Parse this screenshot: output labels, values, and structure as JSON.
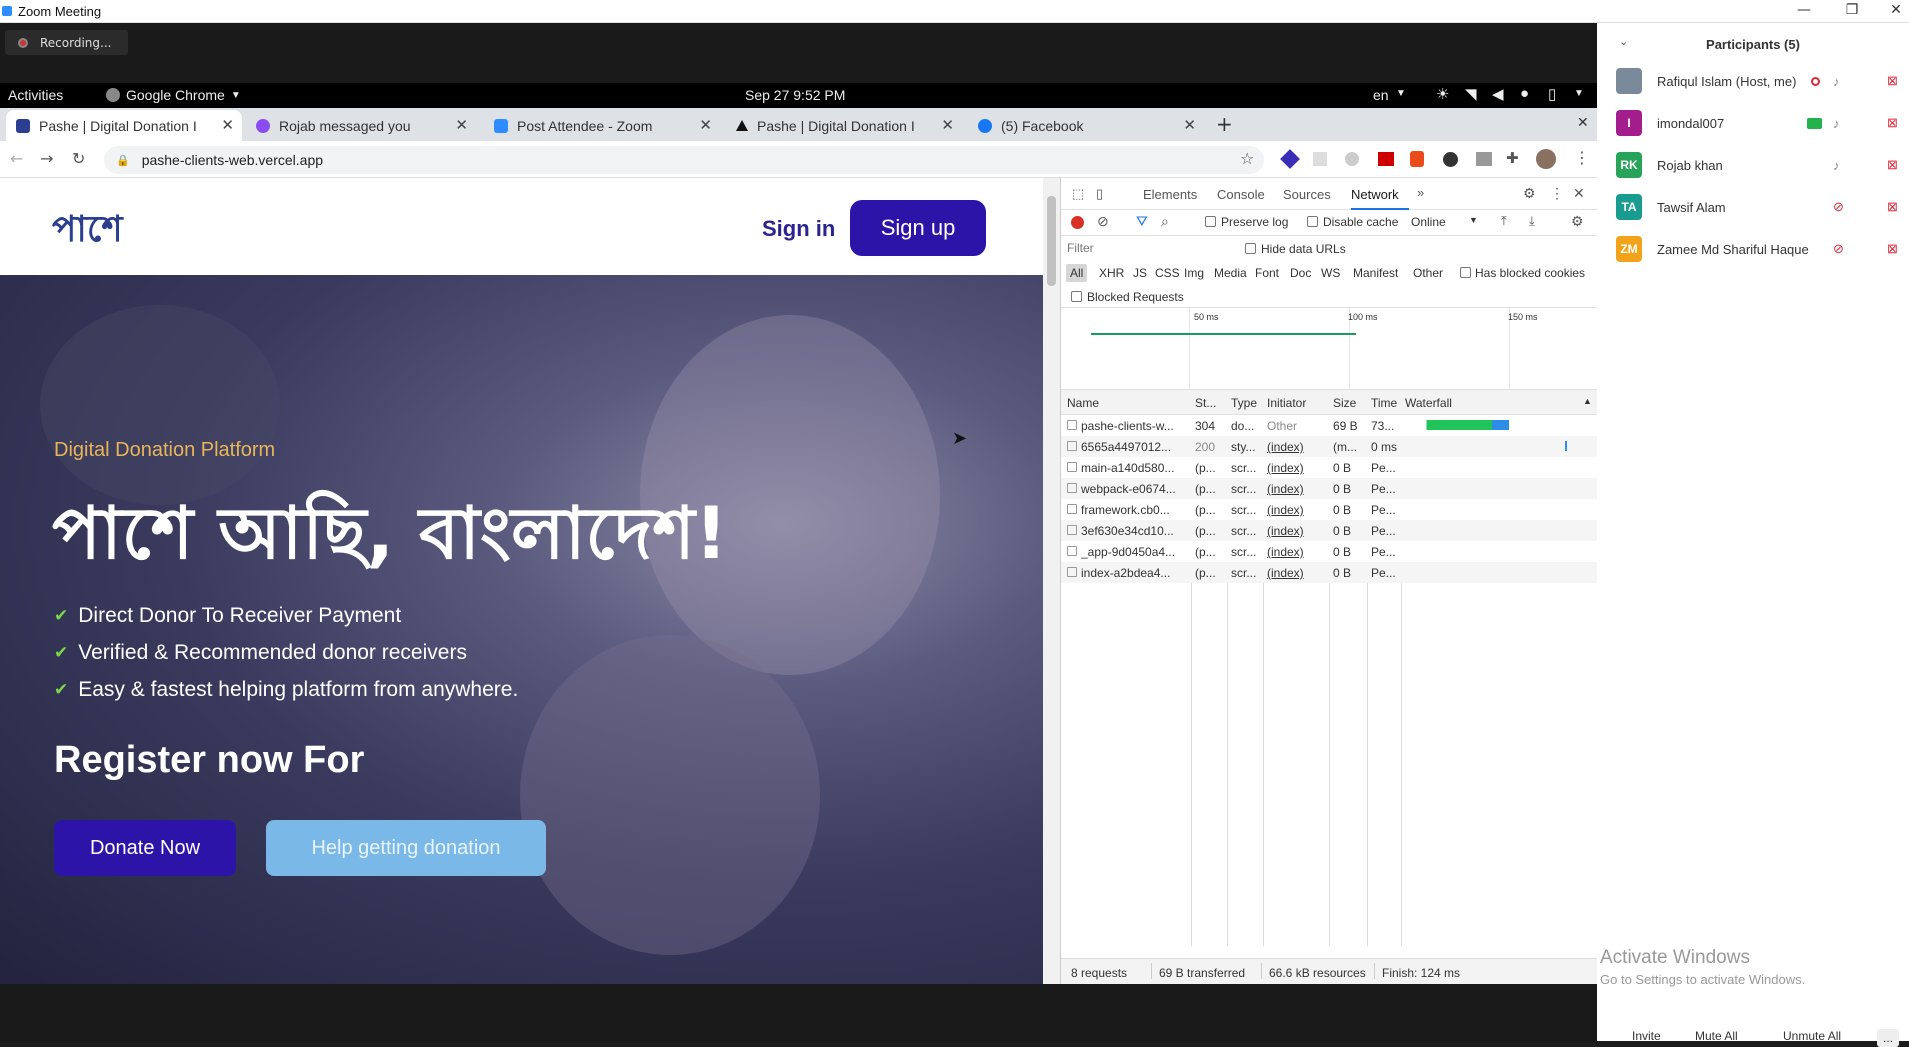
{
  "zoom": {
    "window_title": "Zoom Meeting",
    "recording_label": "Recording...",
    "participants_header": "Participants (5)",
    "participants": [
      {
        "name": "Rafiqul Islam (Host, me)",
        "initials": "",
        "color": "#7a8a9a"
      },
      {
        "name": "imondal007",
        "initials": "I",
        "color": "#a31d8c"
      },
      {
        "name": "Rojab khan",
        "initials": "RK",
        "color": "#27a35a"
      },
      {
        "name": "Tawsif Alam",
        "initials": "TA",
        "color": "#1a9b8f"
      },
      {
        "name": "Zamee Md Shariful Haque",
        "initials": "ZM",
        "color": "#f2a31a"
      }
    ],
    "footer": {
      "invite": "Invite",
      "mute_all": "Mute All",
      "unmute_all": "Unmute All",
      "more": "..."
    },
    "activate_title": "Activate Windows",
    "activate_sub": "Go to Settings to activate Windows."
  },
  "gnome": {
    "activities": "Activities",
    "app": "Google Chrome",
    "datetime": "Sep 27  9:52 PM",
    "lang": "en"
  },
  "tabs": [
    {
      "label": "Pashe | Digital Donation I"
    },
    {
      "label": "Rojab messaged you"
    },
    {
      "label": "Post Attendee - Zoom"
    },
    {
      "label": "Pashe | Digital Donation I"
    },
    {
      "label": "(5) Facebook"
    }
  ],
  "url": "pashe-clients-web.vercel.app",
  "site": {
    "logo": "পাশে",
    "sign_in": "Sign in",
    "sign_up": "Sign up",
    "tagline": "Digital Donation Platform",
    "headline": "পাশে আছি, বাংলাদেশ!",
    "features": [
      "Direct Donor To Receiver Payment",
      "Verified & Recommended donor receivers",
      "Easy & fastest helping platform from anywhere."
    ],
    "register": "Register now For",
    "donate_btn": "Donate Now",
    "help_btn": "Help getting donation"
  },
  "devtools": {
    "tabs": [
      "Elements",
      "Console",
      "Sources",
      "Network"
    ],
    "preserve_log": "Preserve log",
    "disable_cache": "Disable cache",
    "throttle": "Online",
    "filter_placeholder": "Filter",
    "hide_data_urls": "Hide data URLs",
    "types": [
      "All",
      "XHR",
      "JS",
      "CSS",
      "Img",
      "Media",
      "Font",
      "Doc",
      "WS",
      "Manifest",
      "Other"
    ],
    "has_blocked_cookies": "Has blocked cookies",
    "blocked_requests": "Blocked Requests",
    "timeline_ticks": [
      "50 ms",
      "100 ms",
      "150 ms"
    ],
    "columns": [
      "Name",
      "St...",
      "Type",
      "Initiator",
      "Size",
      "Time",
      "Waterfall"
    ],
    "requests": [
      {
        "name": "pashe-clients-w...",
        "status": "304",
        "type": "do...",
        "initiator": "Other",
        "size": "69 B",
        "time": "73..."
      },
      {
        "name": "6565a4497012...",
        "status": "200",
        "type": "sty...",
        "initiator": "(index)",
        "size": "(m...",
        "time": "0 ms"
      },
      {
        "name": "main-a140d580...",
        "status": "(p...",
        "type": "scr...",
        "initiator": "(index)",
        "size": "0 B",
        "time": "Pe..."
      },
      {
        "name": "webpack-e0674...",
        "status": "(p...",
        "type": "scr...",
        "initiator": "(index)",
        "size": "0 B",
        "time": "Pe..."
      },
      {
        "name": "framework.cb0...",
        "status": "(p...",
        "type": "scr...",
        "initiator": "(index)",
        "size": "0 B",
        "time": "Pe..."
      },
      {
        "name": "3ef630e34cd10...",
        "status": "(p...",
        "type": "scr...",
        "initiator": "(index)",
        "size": "0 B",
        "time": "Pe..."
      },
      {
        "name": "_app-9d0450a4...",
        "status": "(p...",
        "type": "scr...",
        "initiator": "(index)",
        "size": "0 B",
        "time": "Pe..."
      },
      {
        "name": "index-a2bdea4...",
        "status": "(p...",
        "type": "scr...",
        "initiator": "(index)",
        "size": "0 B",
        "time": "Pe..."
      }
    ],
    "summary": {
      "requests": "8 requests",
      "transferred": "69 B transferred",
      "resources": "66.6 kB resources",
      "finish": "Finish: 124 ms"
    }
  }
}
